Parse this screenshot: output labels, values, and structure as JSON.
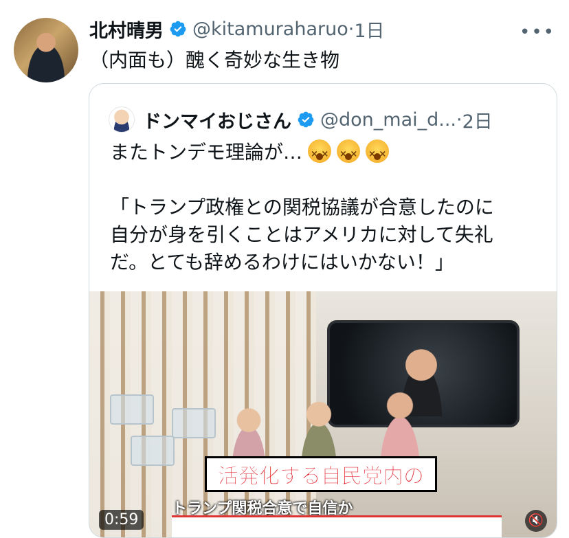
{
  "tweet": {
    "author_name": "北村晴男",
    "handle": "@kitamuraharuo",
    "separator": "·",
    "time": "1日",
    "more_label": "•••",
    "text": "（内面も）醜く奇妙な生き物"
  },
  "quote": {
    "author_name": "ドンマイおじさん",
    "handle": "@don_mai_d...",
    "separator": "·",
    "time": "2日",
    "line1": "またトンデモ理論が…",
    "body_lines": [
      "「トランプ政権との関税協議が合意したのに",
      "自分が身を引くことはアメリカに対して失礼",
      "だ。とても辞めるわけにはいかない！」"
    ],
    "video": {
      "caption_main": "活発化する自民党内の",
      "caption_sub": "トランプ関税合意で自信か",
      "duration": "0:59"
    }
  },
  "colors": {
    "verified": "#1d9bf0",
    "muted_text": "#536471",
    "border": "#cfd9de"
  },
  "icons": {
    "verified": "verified-badge-icon",
    "more": "more-icon",
    "emoji": "dizzy-face-emoji",
    "mute": "speaker-muted-icon"
  }
}
